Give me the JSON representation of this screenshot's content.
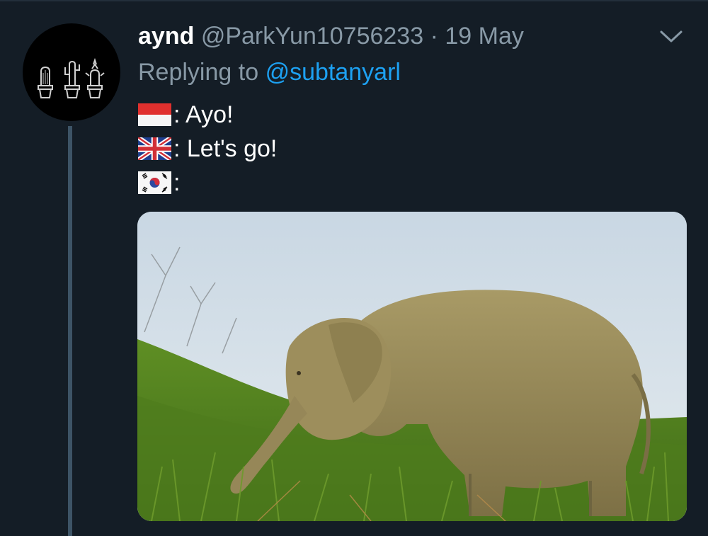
{
  "tweet": {
    "username": "aynd",
    "handle": "@ParkYun10756233",
    "separator": "·",
    "date": "19 May",
    "replying_prefix": "Replying to",
    "replying_to": "@subtanyarl",
    "lines": [
      {
        "flag": "indonesia-flag-icon",
        "text": ": Ayo!"
      },
      {
        "flag": "uk-flag-icon",
        "text": ": Let's go!"
      },
      {
        "flag": "south-korea-flag-icon",
        "text": ":"
      }
    ],
    "media_subject": "elephant grazing on grassy hillside",
    "menu_icon": "chevron-down-icon",
    "avatar_icon": "cactus-pots-icon"
  },
  "colors": {
    "background": "#141d26",
    "secondary_text": "#8899a6",
    "link": "#1da1f2",
    "thread_line": "#3d5466"
  }
}
